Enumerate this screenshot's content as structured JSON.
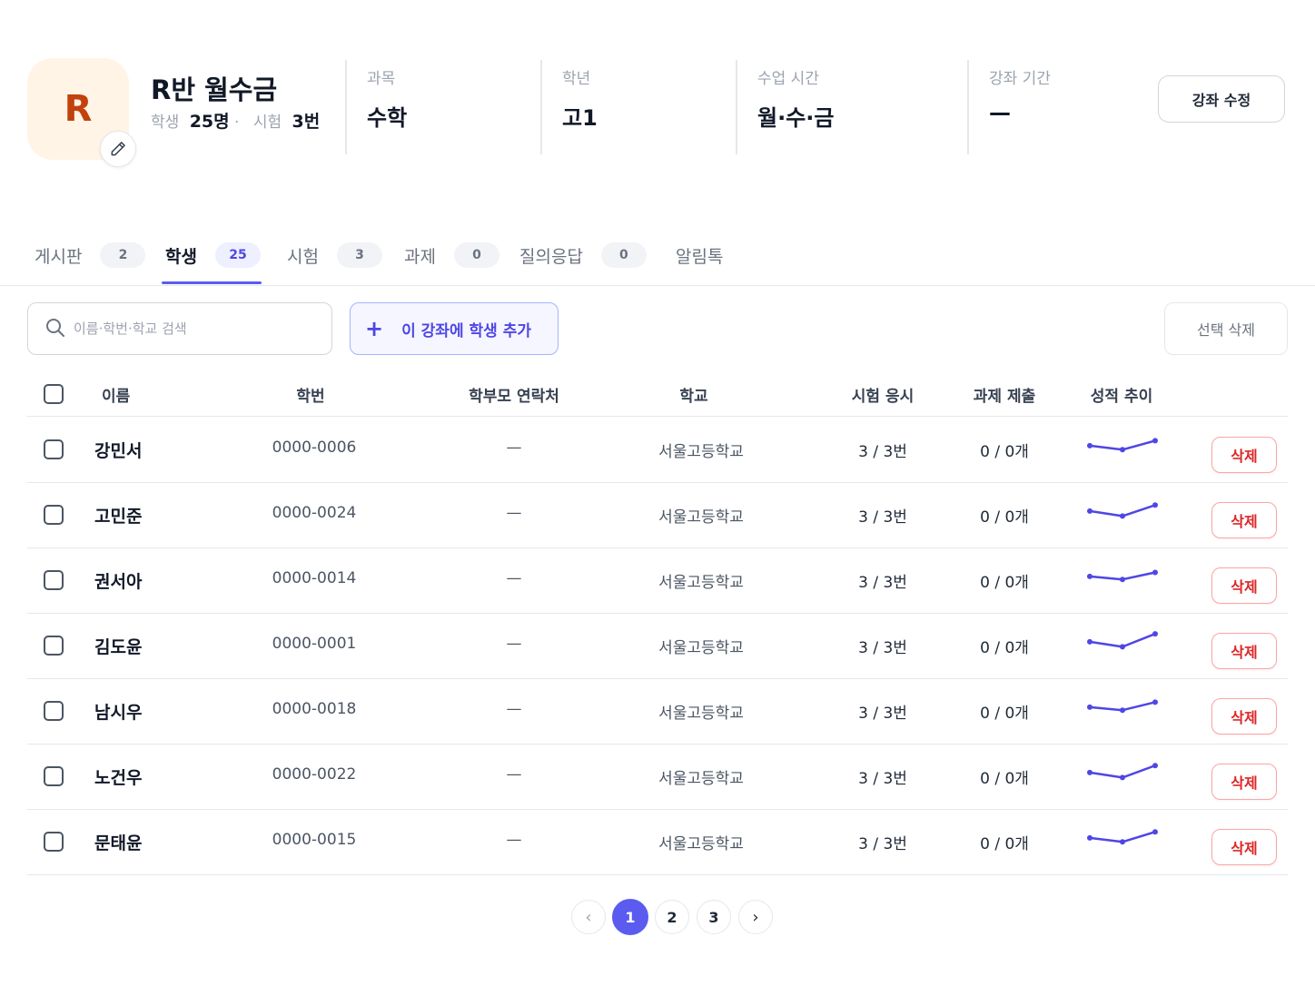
{
  "course": {
    "avatar_letter": "R",
    "title": "R반 월수금",
    "students_label": "학생",
    "students_value": "25명",
    "separator": "·",
    "exams_label": "시험",
    "exams_value": "3번"
  },
  "info": [
    {
      "label": "과목",
      "value": "수학"
    },
    {
      "label": "학년",
      "value": "고1"
    },
    {
      "label": "수업 시간",
      "value": "월·수·금"
    },
    {
      "label": "강좌 기간",
      "value": "—"
    }
  ],
  "edit_course_label": "강좌 수정",
  "tabs": [
    {
      "label": "게시판",
      "count": "2"
    },
    {
      "label": "학생",
      "count": "25",
      "active": true
    },
    {
      "label": "시험",
      "count": "3"
    },
    {
      "label": "과제",
      "count": "0"
    },
    {
      "label": "질의응답",
      "count": "0"
    },
    {
      "label": "알림톡"
    }
  ],
  "toolbar": {
    "search_placeholder": "이름·학번·학교 검색",
    "add_student_label": "이 강좌에 학생 추가",
    "delete_selected_label": "선택 삭제"
  },
  "table": {
    "columns": [
      "이름",
      "학번",
      "학부모 연락처",
      "학교",
      "시험 응시",
      "과제 제출",
      "성적 추이"
    ],
    "delete_label": "삭제",
    "trend_color": "#4F46E5",
    "rows": [
      {
        "name": "강민서",
        "id": "0000-0006",
        "parent_contact": "—",
        "school": "서울고등학교",
        "exams": "3 / 3번",
        "assignments": "0 / 0개",
        "trend": [
          0.55,
          0.35,
          0.8
        ]
      },
      {
        "name": "고민준",
        "id": "0000-0024",
        "parent_contact": "—",
        "school": "서울고등학교",
        "exams": "3 / 3번",
        "assignments": "0 / 0개",
        "trend": [
          0.55,
          0.3,
          0.85
        ]
      },
      {
        "name": "권서아",
        "id": "0000-0014",
        "parent_contact": "—",
        "school": "서울고등학교",
        "exams": "3 / 3번",
        "assignments": "0 / 0개",
        "trend": [
          0.55,
          0.4,
          0.75
        ]
      },
      {
        "name": "김도윤",
        "id": "0000-0001",
        "parent_contact": "—",
        "school": "서울고등학교",
        "exams": "3 / 3번",
        "assignments": "0 / 0개",
        "trend": [
          0.55,
          0.3,
          0.95
        ]
      },
      {
        "name": "남시우",
        "id": "0000-0018",
        "parent_contact": "—",
        "school": "서울고등학교",
        "exams": "3 / 3번",
        "assignments": "0 / 0개",
        "trend": [
          0.55,
          0.4,
          0.8
        ]
      },
      {
        "name": "노건우",
        "id": "0000-0022",
        "parent_contact": "—",
        "school": "서울고등학교",
        "exams": "3 / 3번",
        "assignments": "0 / 0개",
        "trend": [
          0.55,
          0.3,
          0.9
        ]
      },
      {
        "name": "문태윤",
        "id": "0000-0015",
        "parent_contact": "—",
        "school": "서울고등학교",
        "exams": "3 / 3번",
        "assignments": "0 / 0개",
        "trend": [
          0.55,
          0.35,
          0.85
        ]
      }
    ]
  },
  "pagination": {
    "prev": "‹",
    "pages": [
      "1",
      "2",
      "3"
    ],
    "current": "1",
    "next": "›"
  }
}
